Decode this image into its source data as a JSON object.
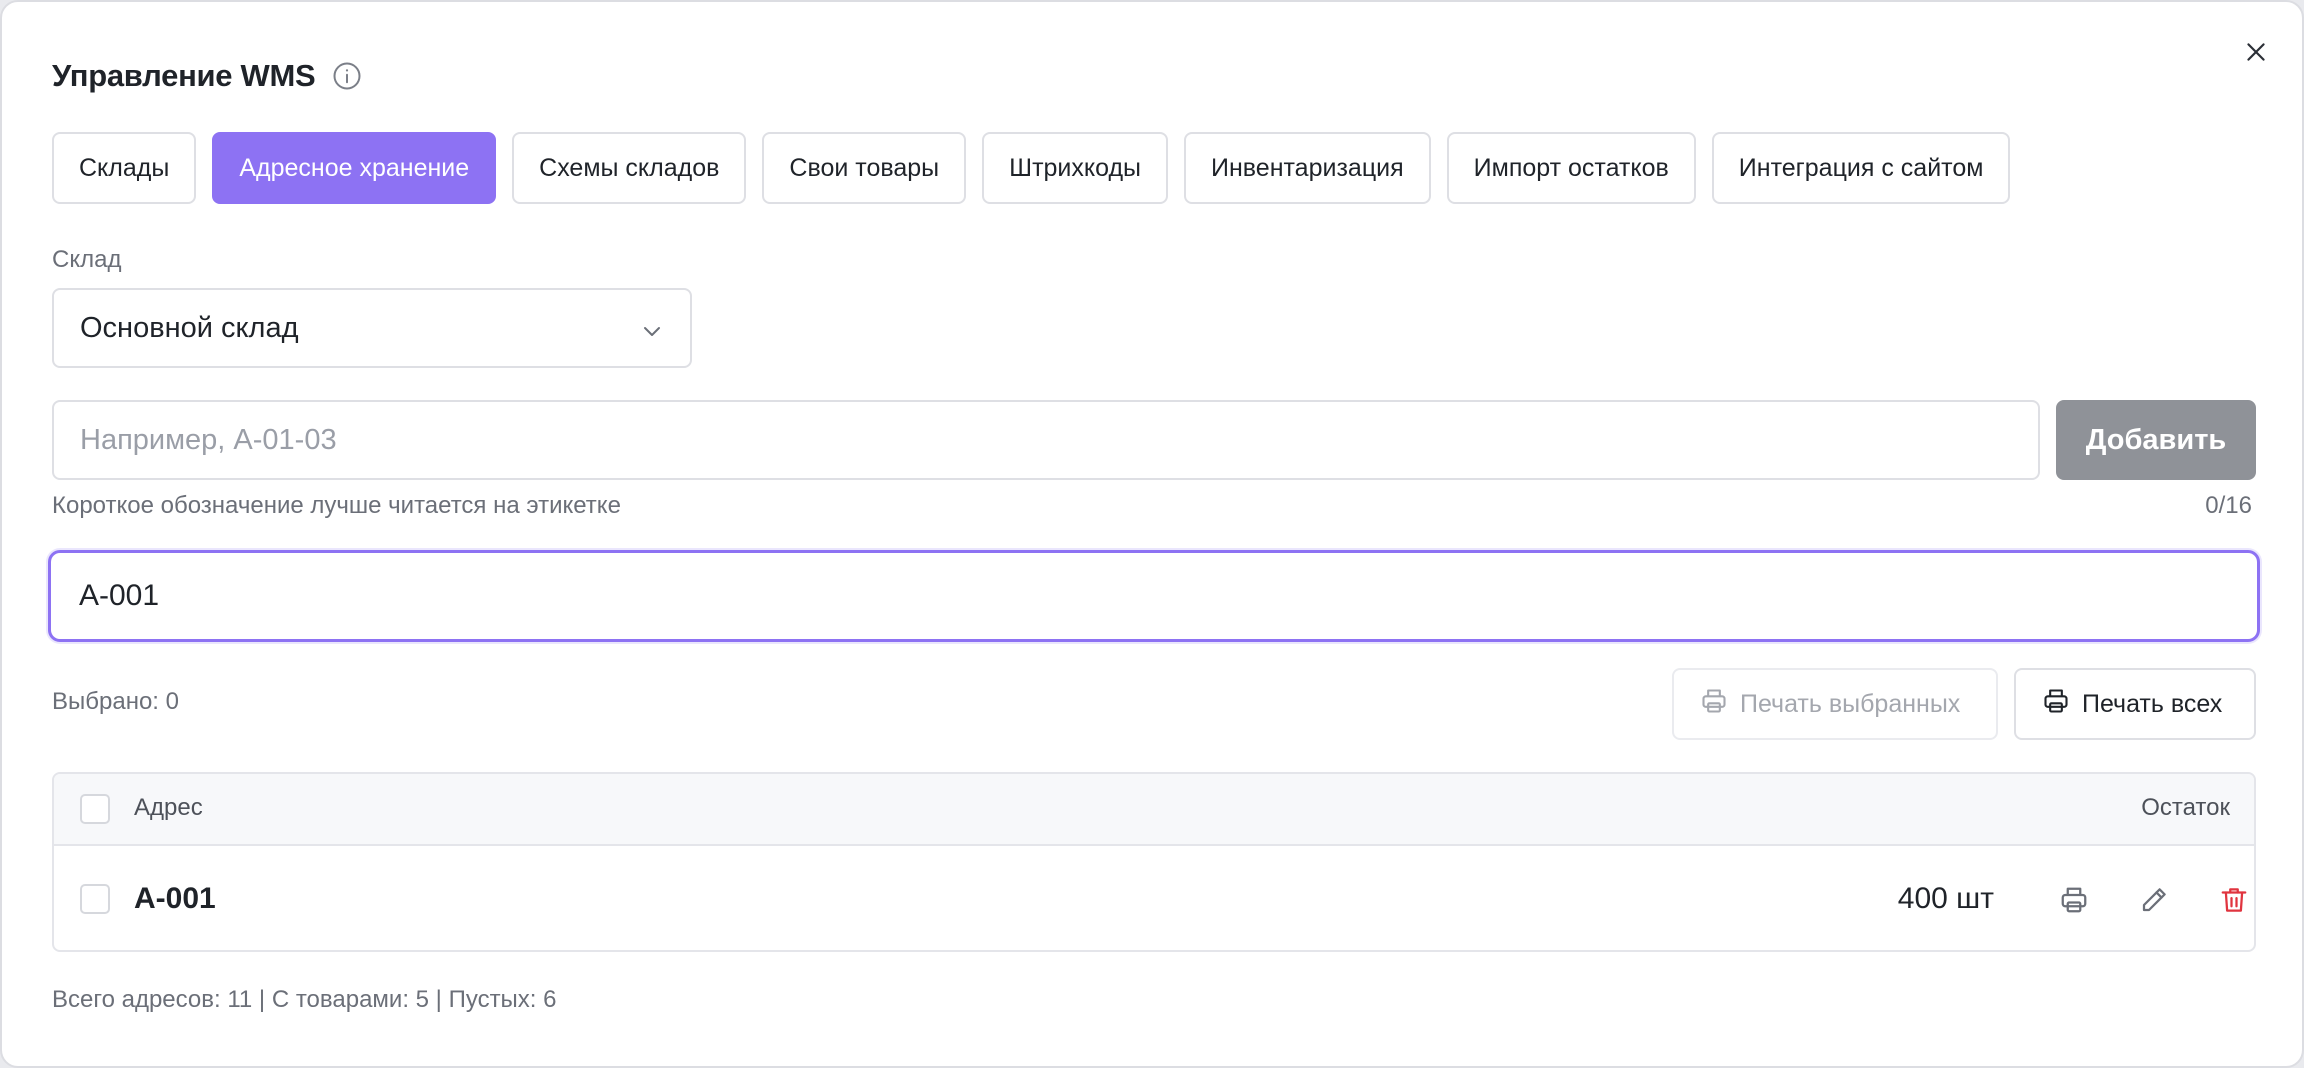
{
  "dialog": {
    "title": "Управление WMS",
    "info_icon": "info-circle-icon",
    "close_icon": "close-icon"
  },
  "tabs": [
    {
      "label": "Склады",
      "active": false
    },
    {
      "label": "Адресное хранение",
      "active": true
    },
    {
      "label": "Схемы складов",
      "active": false
    },
    {
      "label": "Свои товары",
      "active": false
    },
    {
      "label": "Штрихкоды",
      "active": false
    },
    {
      "label": "Инвентаризация",
      "active": false
    },
    {
      "label": "Импорт остатков",
      "active": false
    },
    {
      "label": "Интеграция с сайтом",
      "active": false
    }
  ],
  "warehouse": {
    "label": "Склад",
    "selected": "Основной склад"
  },
  "new_address": {
    "value": "",
    "placeholder": "Например, А-01-03",
    "add_label": "Добавить",
    "hint": "Короткое обозначение лучше читается на этикетке",
    "counter": "0/16"
  },
  "search": {
    "value": "А-001"
  },
  "actions": {
    "selected_text": "Выбрано: 0",
    "print_selected": "Печать выбранных",
    "print_all": "Печать всех"
  },
  "table": {
    "headers": {
      "address": "Адрес",
      "stock": "Остаток"
    },
    "rows": [
      {
        "address": "А-001",
        "stock": "400 шт"
      }
    ]
  },
  "stats": "Всего адресов: 11 | С товарами: 5 | Пустых: 6",
  "colors": {
    "accent": "#8d72f3",
    "disabled_button": "#8f9298",
    "danger": "#e0343f"
  }
}
